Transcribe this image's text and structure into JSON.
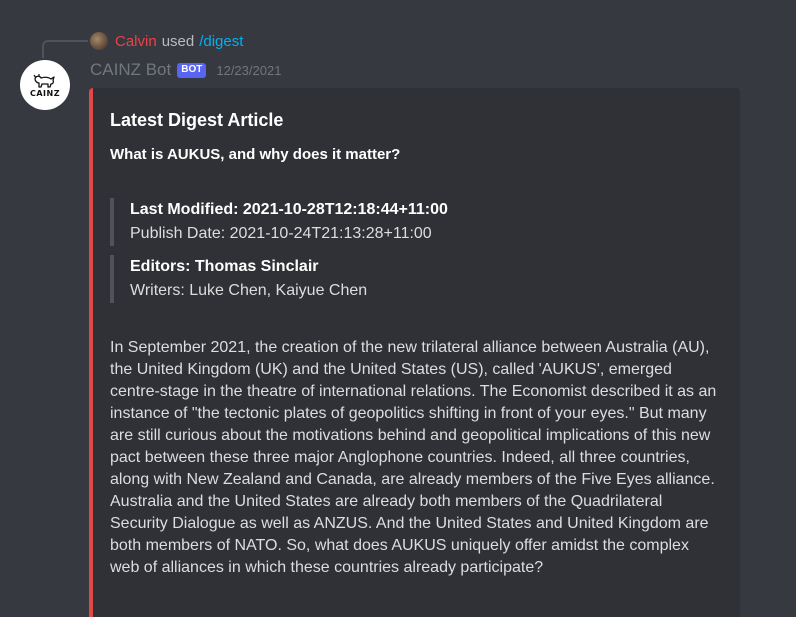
{
  "reply": {
    "user": "Calvin",
    "used": "used",
    "command": "/digest"
  },
  "message": {
    "author": "CAINZ Bot",
    "tag": "BOT",
    "timestamp": "12/23/2021",
    "avatar_text": "CAINZ"
  },
  "embed": {
    "accent_color": "#e04848",
    "title": "Latest Digest Article",
    "subtitle": "What is AUKUS, and why does it matter?",
    "last_modified": "Last Modified: 2021-10-28T12:18:44+11:00",
    "publish_date": "Publish Date: 2021-10-24T21:13:28+11:00",
    "editors": "Editors:  Thomas Sinclair",
    "writers": "Writers: Luke Chen, Kaiyue Chen",
    "body": "In September 2021, the creation of the new trilateral alliance between Australia (AU), the United Kingdom (UK) and the United States (US), called 'AUKUS', emerged centre-stage in the theatre of international relations. The Economist described it as an instance of \"the tectonic plates of geopolitics shifting in front of your eyes.\" But many are still curious about the motivations behind and geopolitical implications of this new pact between these three major Anglophone countries. Indeed, all three countries, along with New Zealand and Canada, are already members of the Five Eyes alliance. Australia and the United States are already both members of the Quadrilateral Security Dialogue as well as ANZUS. And the United States and United Kingdom are both members of NATO. So, what does AUKUS uniquely offer amidst the complex web of alliances in which these countries already participate?"
  }
}
